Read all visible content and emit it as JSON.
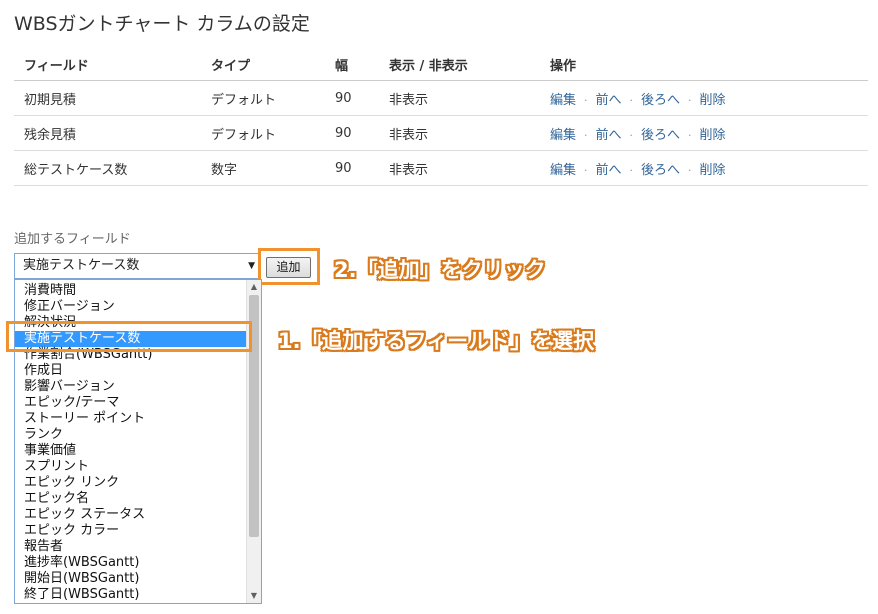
{
  "page": {
    "title": "WBSガントチャート カラムの設定"
  },
  "table": {
    "headers": {
      "field": "フィールド",
      "type": "タイプ",
      "width": "幅",
      "visibility": "表示 / 非表示",
      "actions": "操作"
    },
    "rows": [
      {
        "field": "初期見積",
        "type": "デフォルト",
        "width": "90",
        "visibility": "非表示",
        "edit": "編集",
        "prev": "前へ",
        "next": "後ろへ",
        "delete": "削除"
      },
      {
        "field": "残余見積",
        "type": "デフォルト",
        "width": "90",
        "visibility": "非表示",
        "edit": "編集",
        "prev": "前へ",
        "next": "後ろへ",
        "delete": "削除"
      },
      {
        "field": "総テストケース数",
        "type": "数字",
        "width": "90",
        "visibility": "非表示",
        "edit": "編集",
        "prev": "前へ",
        "next": "後ろへ",
        "delete": "削除"
      }
    ],
    "separator": "·"
  },
  "add_field": {
    "label": "追加するフィールド",
    "selected_value": "実施テストケース数",
    "add_button_label": "追加",
    "options": [
      "消費時間",
      "修正バージョン",
      "解決状況",
      "実施テストケース数",
      "作業割合(WBSGantt)",
      "作成日",
      "影響バージョン",
      "エピック/テーマ",
      "ストーリー ポイント",
      "ランク",
      "事業価値",
      "スプリント",
      "エピック リンク",
      "エピック名",
      "エピック ステータス",
      "エピック カラー",
      "報告者",
      "進捗率(WBSGantt)",
      "開始日(WBSGantt)",
      "終了日(WBSGantt)"
    ],
    "selected_index": 3
  },
  "annotations": {
    "step1": "1.「追加するフィールド」を選択",
    "step2": "2.「追加」をクリック",
    "highlight_color": "#f0922e"
  },
  "colors": {
    "link": "#336699",
    "selection": "#3399ff"
  }
}
